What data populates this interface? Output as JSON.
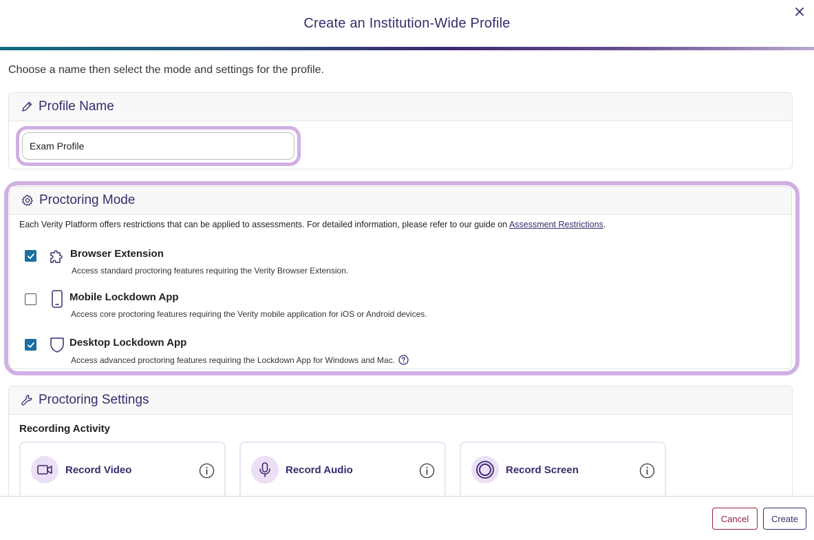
{
  "modal": {
    "title": "Create an Institution-Wide Profile",
    "close_icon": "close-icon"
  },
  "intro": "Choose a name then select the mode and settings for the profile.",
  "profile_name": {
    "title": "Profile Name",
    "icon": "pencil-icon",
    "value": "Exam Profile"
  },
  "proctoring_mode": {
    "title": "Proctoring Mode",
    "icon": "gear-icon",
    "description": "Each Verity Platform offers restrictions that can be applied to assessments. For detailed information, please refer to our guide on ",
    "link_text": "Assessment Restrictions",
    "after_link": ".",
    "items": [
      {
        "label": "Browser Extension",
        "description": "Access standard proctoring features requiring the Verity Browser Extension.",
        "checked": true,
        "icon": "puzzle-icon"
      },
      {
        "label": "Mobile Lockdown App",
        "description": "Access core proctoring features requiring the Verity mobile application for iOS or Android devices.",
        "checked": false,
        "icon": "mobile-phone-icon"
      },
      {
        "label": "Desktop Lockdown App",
        "description": "Access advanced proctoring features requiring the Lockdown App for Windows and Mac.",
        "checked": true,
        "icon": "shield-icon"
      }
    ]
  },
  "proctoring_settings": {
    "title": "Proctoring Settings",
    "icon": "wrench-icon",
    "section_label": "Recording Activity",
    "tiles": [
      {
        "label": "Record Video",
        "icon": "video-camera-icon"
      },
      {
        "label": "Record Audio",
        "icon": "microphone-icon"
      },
      {
        "label": "Record Screen",
        "icon": "screen-record-icon"
      }
    ]
  },
  "footer": {
    "cancel_label": "Cancel",
    "create_label": "Create"
  },
  "colors": {
    "accent": "#3b2a6e",
    "highlight": "#cfb0e3",
    "checkbox": "#1a6fa0",
    "cancel": "#9b1f45"
  }
}
